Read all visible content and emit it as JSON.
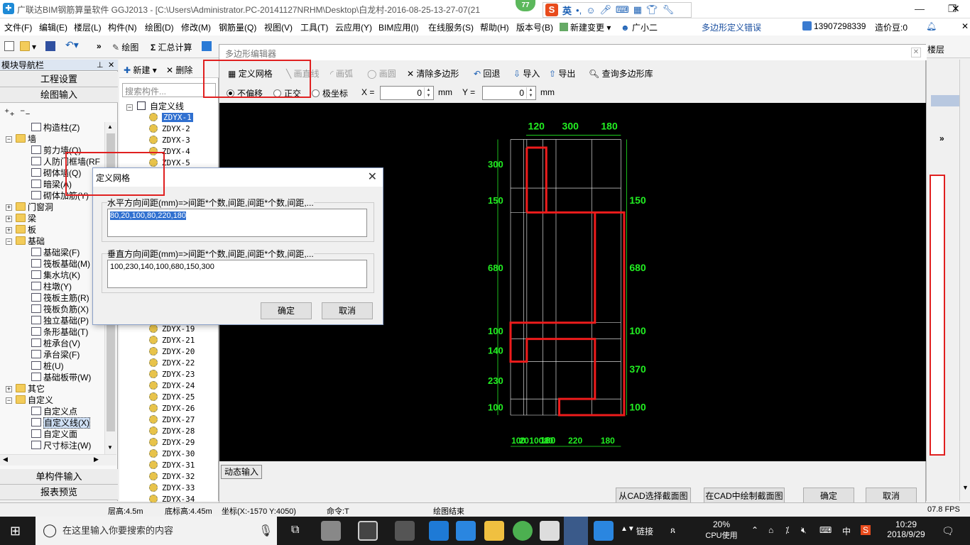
{
  "window": {
    "title": "广联达BIM钢筋算量软件 GGJ2013 - [C:\\Users\\Administrator.PC-20141127NRHM\\Desktop\\白龙村-2016-08-25-13-27-07(21",
    "badge": "77",
    "ime_label": "英"
  },
  "menu": {
    "items": [
      "文件(F)",
      "编辑(E)",
      "楼层(L)",
      "构件(N)",
      "绘图(D)",
      "修改(M)",
      "钢筋量(Q)",
      "视图(V)",
      "工具(T)",
      "云应用(Y)",
      "BIM应用(I)",
      "在线服务(S)",
      "帮助(H)",
      "版本号(B)"
    ],
    "new_change": "新建变更",
    "assistant": "广小二",
    "polygon_error": "多边形定义错误",
    "phone": "13907298339",
    "beans": "造价豆:0"
  },
  "toolbar": {
    "draw": "绘图",
    "sum": "汇总计算",
    "floor": "楼层"
  },
  "leftnav": {
    "header": "模块导航栏",
    "pin": "ᵖ",
    "close": "✕",
    "btn_project": "工程设置",
    "btn_draw": "绘图输入",
    "tree": [
      {
        "label": "构造柱(Z)",
        "level": 2
      },
      {
        "label": "墙",
        "level": 1,
        "folder": true
      },
      {
        "label": "剪力墙(Q)",
        "level": 2
      },
      {
        "label": "人防门框墙(RF",
        "level": 2
      },
      {
        "label": "砌体墙(Q)",
        "level": 2
      },
      {
        "label": "暗梁(A)",
        "level": 2
      },
      {
        "label": "砌体加筋(Y)",
        "level": 2
      },
      {
        "label": "门窗洞",
        "level": 1,
        "folder": true
      },
      {
        "label": "梁",
        "level": 1,
        "folder": true
      },
      {
        "label": "板",
        "level": 1,
        "folder": true
      },
      {
        "label": "基础",
        "level": 1,
        "folder": true
      },
      {
        "label": "基础梁(F)",
        "level": 2
      },
      {
        "label": "筏板基础(M)",
        "level": 2
      },
      {
        "label": "集水坑(K)",
        "level": 2
      },
      {
        "label": "柱墩(Y)",
        "level": 2
      },
      {
        "label": "筏板主筋(R)",
        "level": 2
      },
      {
        "label": "筏板负筋(X)",
        "level": 2
      },
      {
        "label": "独立基础(P)",
        "level": 2
      },
      {
        "label": "条形基础(T)",
        "level": 2
      },
      {
        "label": "桩承台(V)",
        "level": 2
      },
      {
        "label": "承台梁(F)",
        "level": 2
      },
      {
        "label": "桩(U)",
        "level": 2
      },
      {
        "label": "基础板带(W)",
        "level": 2
      },
      {
        "label": "其它",
        "level": 1,
        "folder": true
      },
      {
        "label": "自定义",
        "level": 1,
        "folder": true
      },
      {
        "label": "自定义点",
        "level": 2
      },
      {
        "label": "自定义线(X)",
        "level": 2,
        "selected": true
      },
      {
        "label": "自定义面",
        "level": 2
      },
      {
        "label": "尺寸标注(W)",
        "level": 2
      }
    ],
    "btn_single": "单构件输入",
    "btn_report": "报表预览"
  },
  "comppanel": {
    "new": "新建",
    "delete": "删除",
    "search_placeholder": "搜索构件...",
    "root": "自定义线",
    "items_top": [
      "ZDYX-1",
      "ZDYX-2",
      "ZDYX-3",
      "ZDYX-4",
      "ZDYX-5"
    ],
    "items_bottom": [
      "ZDYX-19",
      "ZDYX-21",
      "ZDYX-20",
      "ZDYX-22",
      "ZDYX-23",
      "ZDYX-24",
      "ZDYX-25",
      "ZDYX-26",
      "ZDYX-27",
      "ZDYX-28",
      "ZDYX-29",
      "ZDYX-30",
      "ZDYX-31",
      "ZDYX-32",
      "ZDYX-33",
      "ZDYX-34"
    ]
  },
  "editor": {
    "title": "多边形编辑器",
    "close": "✕",
    "tb_define_grid": "定义网格",
    "tb_draw_line": "画直线",
    "tb_draw_arc": "画弧",
    "tb_draw_circle": "画圆",
    "tb_clear": "清除多边形",
    "tb_undo": "回退",
    "tb_import": "导入",
    "tb_export": "导出",
    "tb_query": "查询多边形库",
    "opt_no_offset": "不偏移",
    "opt_ortho": "正交",
    "opt_polar": "极坐标",
    "x_label": "X =",
    "x_value": "0",
    "y_label": "Y =",
    "y_value": "0",
    "unit": "mm",
    "dynamic_input": "动态输入",
    "btn_from_cad": "从CAD选择截面图",
    "btn_draw_in_cad": "在CAD中绘制截面图",
    "btn_ok": "确定",
    "btn_cancel": "取消"
  },
  "canvas": {
    "grid_color": "#ffffff",
    "label_color": "#22ee22",
    "poly_color": "#ee1c1c",
    "top_dims": [
      "120",
      "300",
      "180"
    ],
    "bottom_dims": [
      "100",
      "20",
      "100",
      "80",
      "220",
      "180"
    ],
    "bottom_dims_overlay": [
      "180"
    ],
    "left_dims": [
      "300",
      "150",
      "680",
      "100",
      "140",
      "230",
      "100"
    ],
    "right_dims": [
      "150",
      "680",
      "100",
      "370",
      "100"
    ]
  },
  "griddlg": {
    "title": "定义网格",
    "close": "✕",
    "h_label": "水平方向间距(mm)=>间距*个数,间距,间距*个数,间距,...",
    "h_value": "80,20,100,80,220,180",
    "v_label": "垂直方向间距(mm)=>间距*个数,间距,间距*个数,间距,...",
    "v_value": "100,230,140,100,680,150,300",
    "ok": "确定",
    "cancel": "取消"
  },
  "statusbar": {
    "floor_height": "层高:4.5m",
    "base_height": "底标高:4.45m",
    "coords": "坐标(X:-1570 Y:4050)",
    "cmd": "命令:T",
    "status": "绘图结束",
    "fps": "07.8 FPS"
  },
  "taskbar": {
    "search_placeholder": "在这里输入你要搜索的内容",
    "network": "链接",
    "cpu_pct": "20%",
    "cpu_label": "CPU使用",
    "lang": "中",
    "time": "10:29",
    "date": "2018/9/29"
  }
}
